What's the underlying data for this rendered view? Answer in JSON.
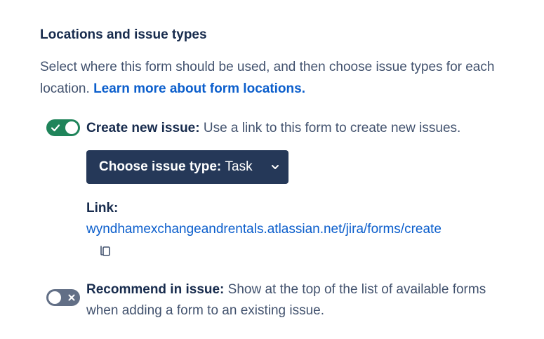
{
  "section": {
    "title": "Locations and issue types",
    "description": "Select where this form should be used, and then choose issue types for each location.",
    "learn_more_link": "Learn more about form locations."
  },
  "create_issue": {
    "enabled": true,
    "label": "Create new issue:",
    "description": "Use a link to this form to create new issues.",
    "toggle_icon": "check-icon",
    "dropdown_label": "Choose issue type:",
    "dropdown_value": "Task",
    "link_label": "Link:",
    "link_url": "wyndhamexchangeandrentals.atlassian.net/jira/forms/create",
    "copy_icon": "copy-icon"
  },
  "recommend_issue": {
    "enabled": false,
    "label": "Recommend in issue:",
    "description": "Show at the top of the list of available forms when adding a form to an existing issue.",
    "toggle_icon": "cross-icon"
  },
  "colors": {
    "toggle_on": "#1f845a",
    "toggle_off": "#626f86",
    "dropdown_bg": "#253858",
    "link": "#0b5ecc",
    "text_primary": "#172b4d",
    "text_secondary": "#42526e"
  }
}
